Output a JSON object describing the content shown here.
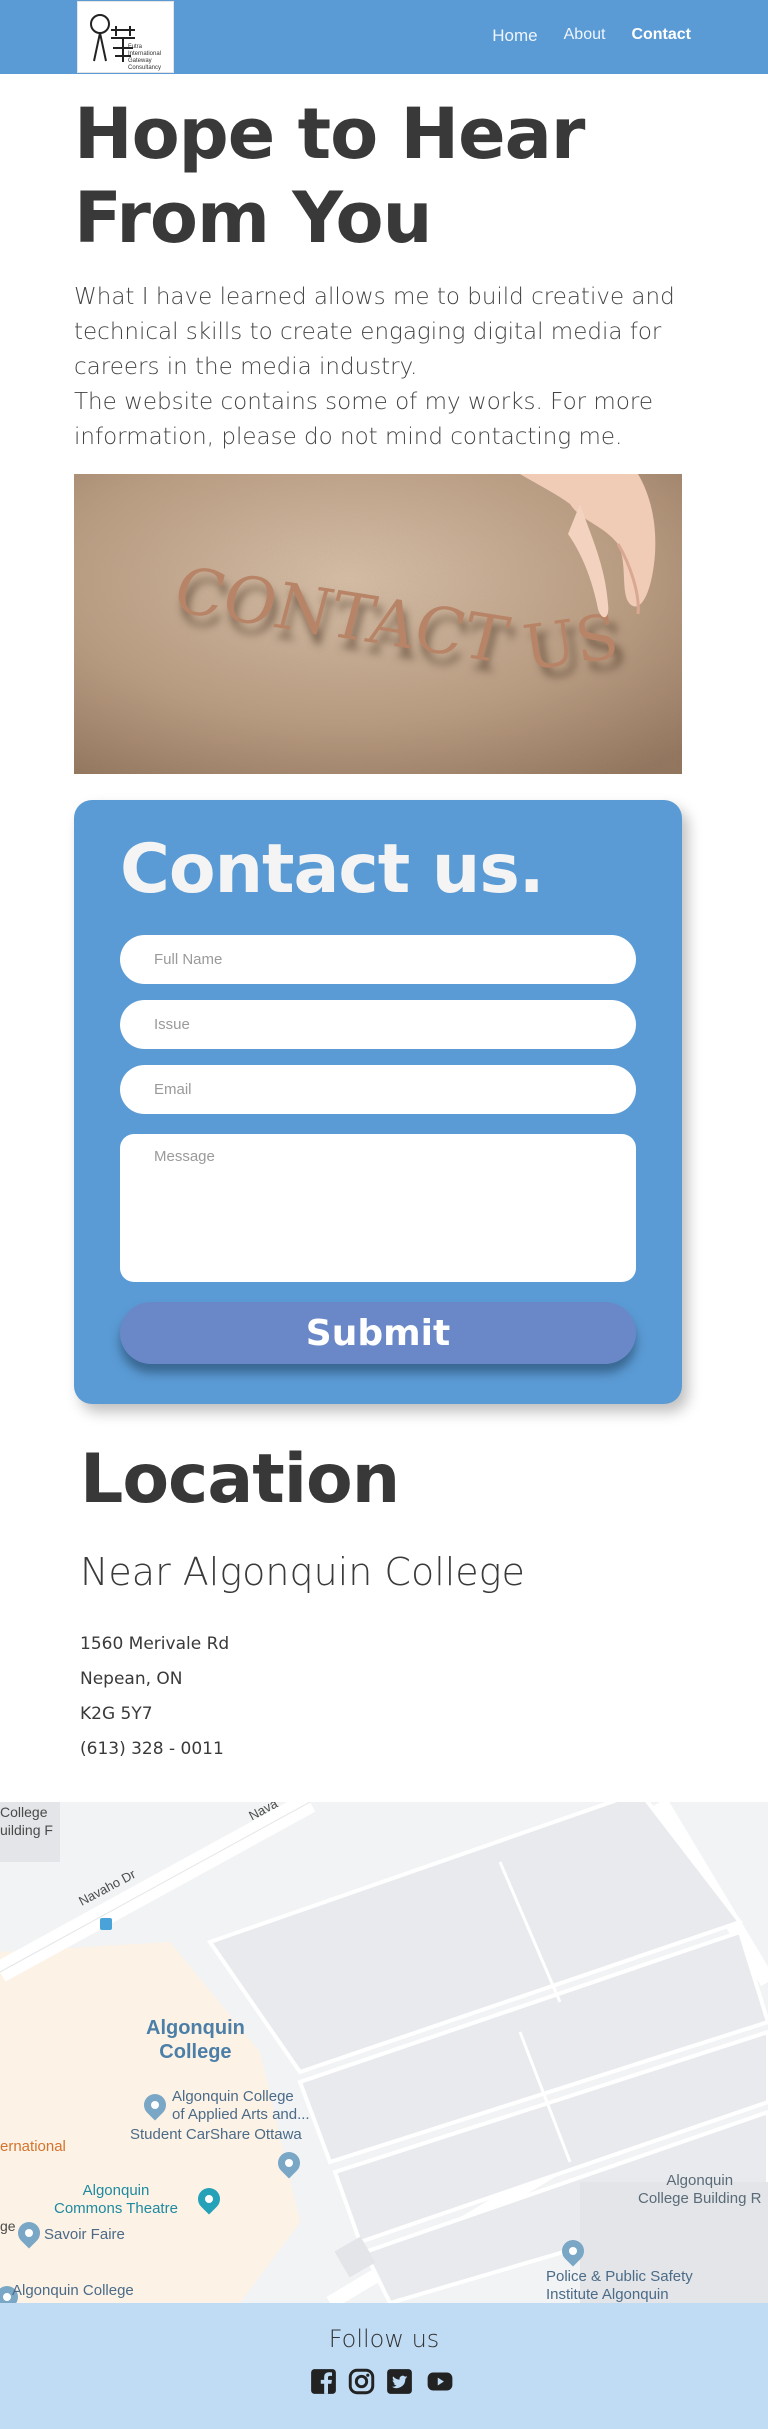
{
  "nav": {
    "logo_text": "Futra International Gateway Consultancy",
    "links": [
      {
        "label": "Home"
      },
      {
        "label": "About"
      },
      {
        "label": "Contact"
      }
    ]
  },
  "hero": {
    "title_line1": "Hope to Hear",
    "title_line2": "From You",
    "para1": "What I have learned allows me to build creative and technical skills to create engaging digital media for careers in the media industry.",
    "para2": "The website contains some of my works. For more information, please do not mind contacting me."
  },
  "photo": {
    "word1": "CONTACT",
    "word2": "US"
  },
  "contact_form": {
    "title": "Contact us.",
    "full_name_placeholder": "Full Name",
    "issue_placeholder": "Issue",
    "email_placeholder": "Email",
    "message_placeholder": "Message",
    "submit_label": "Submit"
  },
  "location": {
    "title": "Location",
    "subtitle": "Near Algonquin College",
    "street": "1560 Merivale Rd",
    "city": "Nepean, ON",
    "postal": "K2G 5Y7",
    "phone": "(613) 328 - 0011"
  },
  "map": {
    "labels": {
      "college_top": "College",
      "building_f": "uilding F",
      "navaho": "Navaho Dr",
      "navaho2": "Nava",
      "algonquin_college": "Algonquin\nCollege",
      "aaa": "Algonquin College\nof Applied Arts and...",
      "carshare": "Student CarShare Ottawa",
      "international": "ernational",
      "commons": "Algonquin\nCommons Theatre",
      "savoir": "Savoir Faire",
      "ge": "ge",
      "ac_bottom": "Algonquin College",
      "acb": "Algonquin\nCollege Building R",
      "police": "Police & Public Safety\nInstitute Algonquin"
    }
  },
  "footer": {
    "follow": "Follow us",
    "social_icons": [
      "facebook-icon",
      "instagram-icon",
      "twitter-icon",
      "youtube-icon"
    ]
  },
  "colors": {
    "primary": "#5b9bd5",
    "submit": "#6a88c8",
    "footer": "#bfdcf4"
  }
}
